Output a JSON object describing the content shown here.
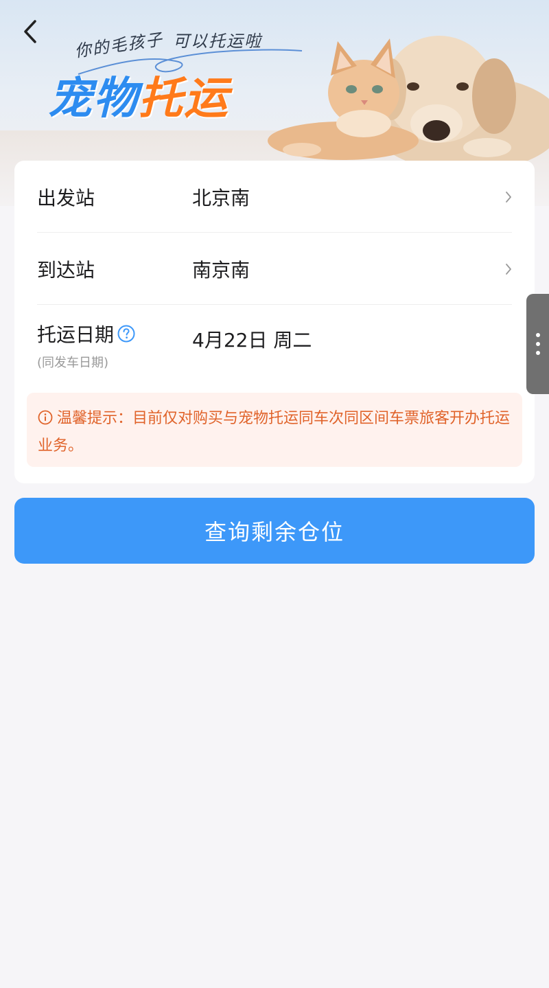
{
  "banner": {
    "script_line1": "你的毛孩子",
    "script_line2": "可以托运啦",
    "title_part1": "宠物",
    "title_part2": "托运"
  },
  "form": {
    "departure": {
      "label": "出发站",
      "value": "北京南"
    },
    "arrival": {
      "label": "到达站",
      "value": "南京南"
    },
    "date": {
      "label": "托运日期",
      "sublabel": "(同发车日期)",
      "value": "4月22日 周二"
    }
  },
  "notice": {
    "text": "温馨提示：目前仅对购买与宠物托运同车次同区间车票旅客开办托运业务。"
  },
  "submit": {
    "label": "查询剩余仓位"
  },
  "colors": {
    "accent": "#3d98f9",
    "title_blue": "#2d8cf0",
    "title_orange": "#ff7a1a",
    "notice_text": "#e0632a",
    "notice_bg": "#fff2ee",
    "background": "#f6f5f8"
  },
  "icons": {
    "back": "chevron-left-icon",
    "row_arrow": "chevron-right-icon",
    "help": "question-circle-icon",
    "notice": "info-circle-icon",
    "side_menu": "more-vertical-icon"
  }
}
